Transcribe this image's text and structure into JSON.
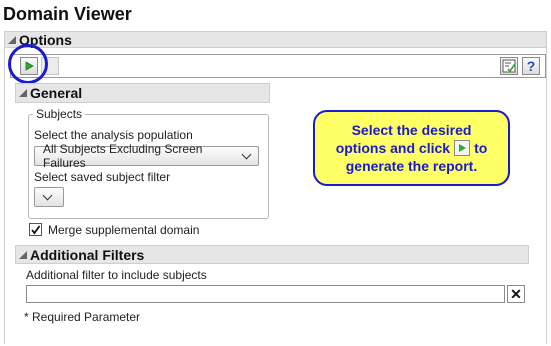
{
  "window": {
    "title": "Domain Viewer"
  },
  "options_section": {
    "title": "Options"
  },
  "toolbar": {
    "run_icon": "play-icon",
    "report_icon": "report-check-icon",
    "help_icon": "help-icon",
    "help_glyph": "?"
  },
  "general_section": {
    "title": "General",
    "subjects_group": {
      "label": "Subjects",
      "population_label": "Select the analysis population",
      "population_value": "All Subjects Excluding Screen Failures",
      "filter_label": "Select saved subject filter",
      "filter_value": ""
    },
    "merge_checkbox": {
      "label": "Merge supplemental domain",
      "checked": true
    }
  },
  "additional_filters": {
    "title": "Additional Filters",
    "filter_label": "Additional filter to include subjects",
    "filter_value": "",
    "clear_glyph": "✕"
  },
  "footer": {
    "required_note": "* Required Parameter"
  },
  "callout": {
    "line1": "Select the desired",
    "line2_before": "options and click",
    "line2_after": "to",
    "line3": "generate the report."
  },
  "colors": {
    "callout_bg": "#ffff66",
    "callout_border": "#1a1ad0",
    "highlight_ring": "#1a1ad0",
    "run_green": "#2eaa2e"
  }
}
